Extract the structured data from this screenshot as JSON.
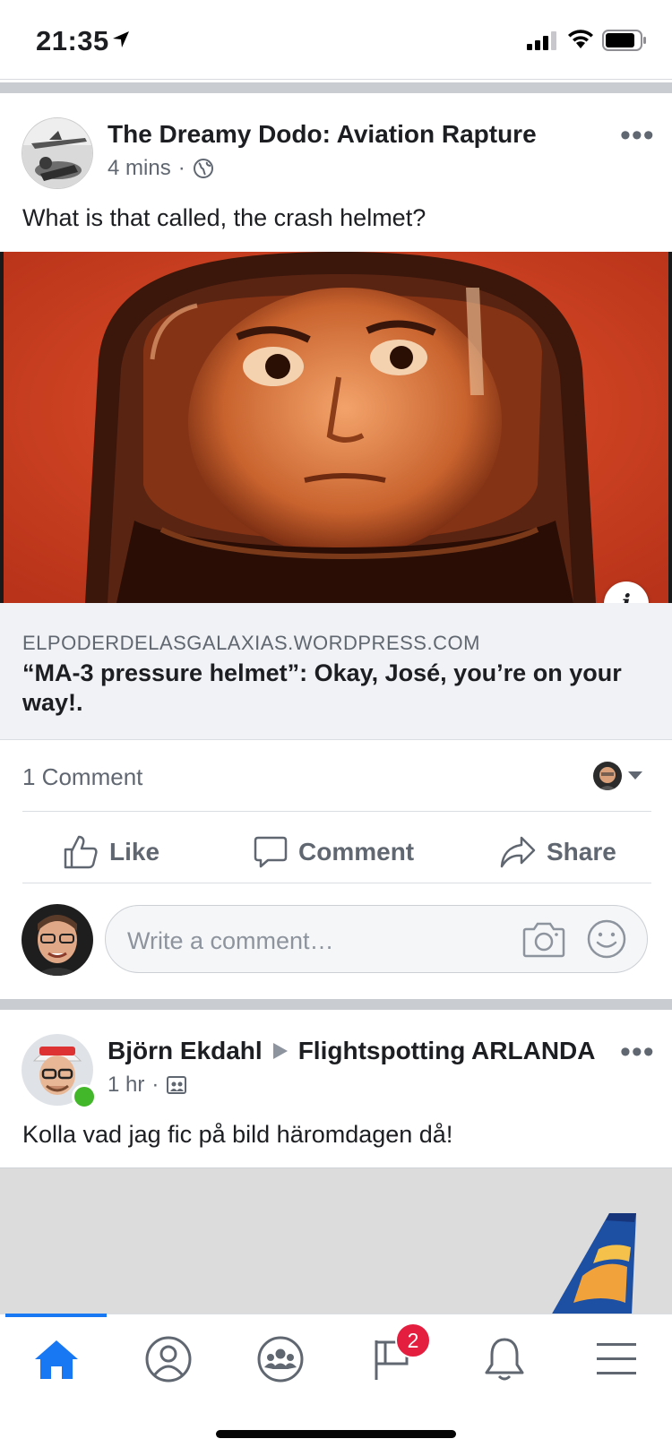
{
  "status_bar": {
    "time": "21:35"
  },
  "post1": {
    "author": "The Dreamy Dodo: Aviation Rapture",
    "time": "4 mins",
    "text": "What is that called, the crash helmet?",
    "link": {
      "domain": "ELPODERDELASGALAXIAS.WORDPRESS.COM",
      "title": "“MA-3 pressure helmet”: Okay, José, you’re on your way!."
    },
    "info_label": "i",
    "comments_count": "1 Comment",
    "actions": {
      "like": "Like",
      "comment": "Comment",
      "share": "Share"
    },
    "comment_placeholder": "Write a comment…"
  },
  "post2": {
    "author": "Björn Ekdahl",
    "group": "Flightspotting ARLANDA",
    "time": "1 hr",
    "text": "Kolla vad jag fic på bild häromdagen då!"
  },
  "nav": {
    "items": [
      "home",
      "profile",
      "groups",
      "pages",
      "notifications",
      "menu"
    ],
    "active": "home",
    "pages_badge": "2",
    "accent_color": "#1877f2",
    "badge_color": "#e41e3f"
  }
}
